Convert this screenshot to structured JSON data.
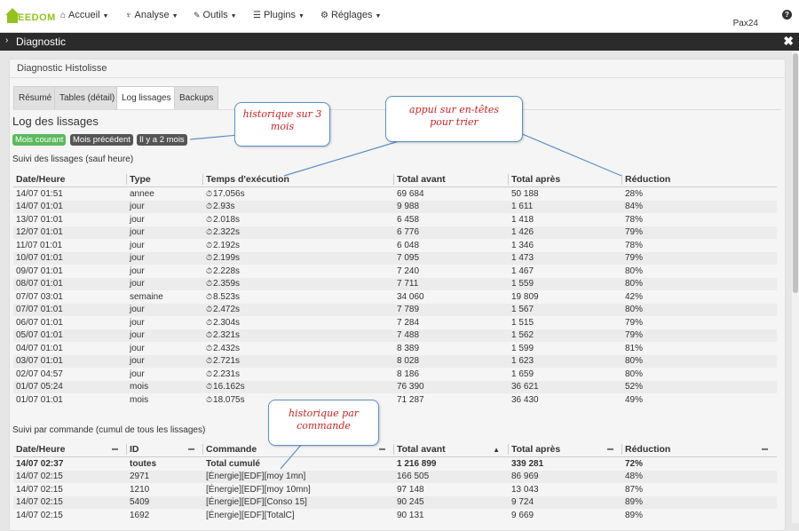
{
  "navbar": {
    "logo_text": "EEDOM",
    "menus": [
      {
        "label": "Accueil",
        "icon": "home-icon",
        "glyph": "⌂"
      },
      {
        "label": "Analyse",
        "icon": "stethoscope-icon",
        "glyph": "♆"
      },
      {
        "label": "Outils",
        "icon": "wrench-icon",
        "glyph": "🔧"
      },
      {
        "label": "Plugins",
        "icon": "tasks-icon",
        "glyph": "☰"
      },
      {
        "label": "Réglages",
        "icon": "gear-icon",
        "glyph": "⚙"
      }
    ],
    "user": "Pax24",
    "help_glyph": "?"
  },
  "modal": {
    "title": "Diagnostic",
    "chevron": "›",
    "close_glyph": "✖"
  },
  "panel": {
    "heading": "Diagnostic Histolisse",
    "tabs": [
      "Résumé",
      "Tables (détail)",
      "Log lissages",
      "Backups"
    ],
    "active_tab": "Log lissages",
    "section_title": "Log des lissages",
    "period_buttons": [
      {
        "label": "Mois courant",
        "color": "#5cb85c"
      },
      {
        "label": "Mois précédent",
        "color": "#555555"
      },
      {
        "label": "Il y a 2 mois",
        "color": "#555555"
      }
    ]
  },
  "table1": {
    "caption": "Suivi des lissages (sauf heure)",
    "headers": [
      "Date/Heure",
      "Type",
      "Temps d'exécution",
      "Total avant",
      "Total après",
      "Réduction"
    ],
    "rows": [
      [
        "14/07 01:51",
        "annee",
        "17.056s",
        "69 684",
        "50 188",
        "28%"
      ],
      [
        "14/07 01:01",
        "jour",
        "2.93s",
        "9 988",
        "1 611",
        "84%"
      ],
      [
        "13/07 01:01",
        "jour",
        "2.018s",
        "6 458",
        "1 418",
        "78%"
      ],
      [
        "12/07 01:01",
        "jour",
        "2.322s",
        "6 776",
        "1 426",
        "79%"
      ],
      [
        "11/07 01:01",
        "jour",
        "2.192s",
        "6 048",
        "1 346",
        "78%"
      ],
      [
        "10/07 01:01",
        "jour",
        "2.199s",
        "7 095",
        "1 473",
        "79%"
      ],
      [
        "09/07 01:01",
        "jour",
        "2.228s",
        "7 240",
        "1 467",
        "80%"
      ],
      [
        "08/07 01:01",
        "jour",
        "2.359s",
        "7 711",
        "1 559",
        "80%"
      ],
      [
        "07/07 03:01",
        "semaine",
        "8.523s",
        "34 060",
        "19 809",
        "42%"
      ],
      [
        "07/07 01:01",
        "jour",
        "2.472s",
        "7 789",
        "1 567",
        "80%"
      ],
      [
        "06/07 01:01",
        "jour",
        "2.304s",
        "7 284",
        "1 515",
        "79%"
      ],
      [
        "05/07 01:01",
        "jour",
        "2.321s",
        "7 488",
        "1 562",
        "79%"
      ],
      [
        "04/07 01:01",
        "jour",
        "2.432s",
        "8 389",
        "1 599",
        "81%"
      ],
      [
        "03/07 01:01",
        "jour",
        "2.721s",
        "8 028",
        "1 623",
        "80%"
      ],
      [
        "02/07 04:57",
        "jour",
        "2.231s",
        "8 186",
        "1 659",
        "80%"
      ],
      [
        "01/07 05:24",
        "mois",
        "16.162s",
        "76 390",
        "36 621",
        "52%"
      ],
      [
        "01/07 01:01",
        "mois",
        "18.075s",
        "71 287",
        "36 430",
        "49%"
      ]
    ]
  },
  "table2": {
    "caption": "Suivi par commande (cumul de tous les lissages)",
    "headers": [
      "Date/Heure",
      "ID",
      "Commande",
      "Total avant",
      "Total après",
      "Réduction"
    ],
    "rows": [
      [
        "14/07 02:37",
        "toutes",
        "Total cumulé",
        "1 216 899",
        "339 281",
        "72%"
      ],
      [
        "14/07 02:15",
        "2971",
        "[Énergie][EDF][moy 1mn]",
        "166 505",
        "86 969",
        "48%"
      ],
      [
        "14/07 02:15",
        "1210",
        "[Énergie][EDF][moy 10mn]",
        "97 148",
        "13 043",
        "87%"
      ],
      [
        "14/07 02:15",
        "5409",
        "[Énergie][EDF][Conso 15]",
        "90 245",
        "9 724",
        "89%"
      ],
      [
        "14/07 02:15",
        "1692",
        "[Énergie][EDF][TotalC]",
        "90 131",
        "9 669",
        "89%"
      ]
    ]
  },
  "callouts": {
    "history": "historique sur 3 mois",
    "sort": "appui sur en-têtes pour trier",
    "per_command": "historique par commande"
  },
  "colors": {
    "callout_text": "#cc2222",
    "callout_border": "#5a90c8",
    "logo": "#94c11f"
  }
}
